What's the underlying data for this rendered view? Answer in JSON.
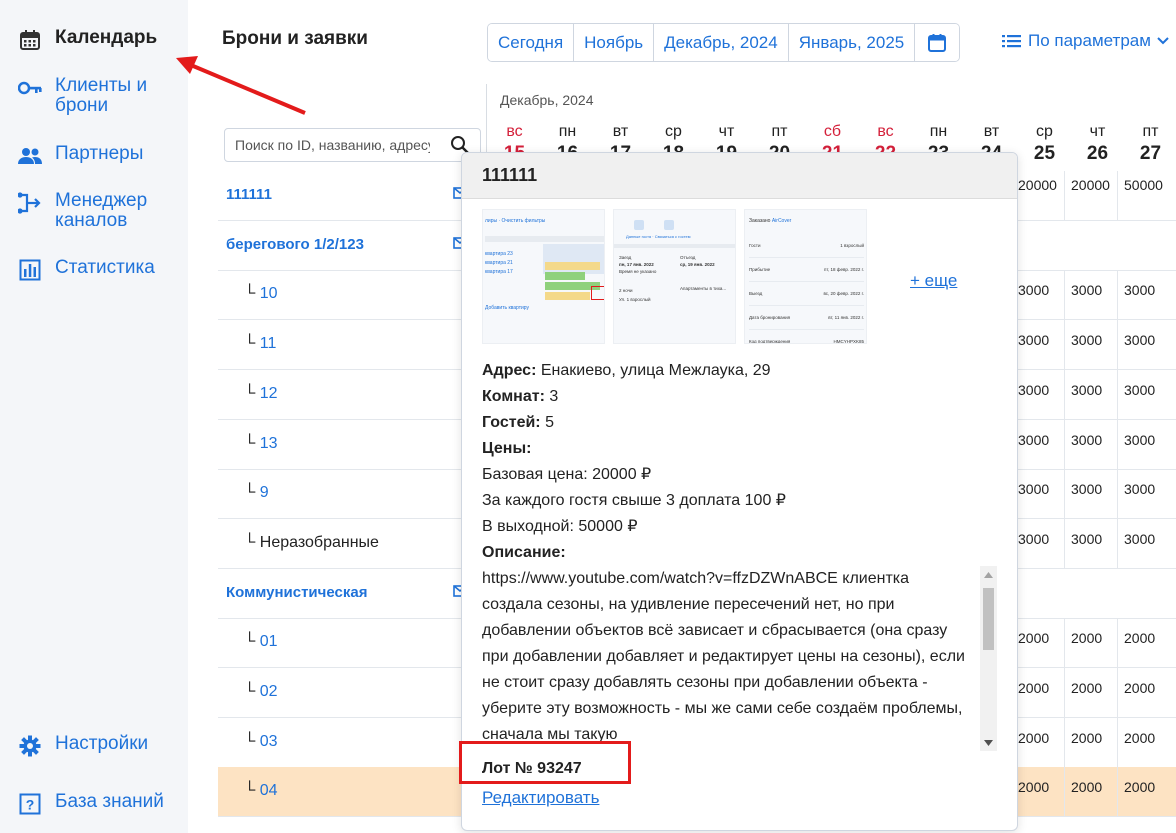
{
  "sidebar": {
    "items": [
      {
        "label": "Календарь",
        "icon": "calendar-icon",
        "active": true
      },
      {
        "label": "Клиенты и брони",
        "icon": "key-icon"
      },
      {
        "label": "Партнеры",
        "icon": "people-icon"
      },
      {
        "label": "Менеджер каналов",
        "icon": "channels-icon"
      },
      {
        "label": "Статистика",
        "icon": "bar-chart-icon"
      }
    ],
    "bottom": [
      {
        "label": "Настройки",
        "icon": "gear-icon"
      },
      {
        "label": "База знаний",
        "icon": "question-icon"
      }
    ]
  },
  "header": {
    "title": "Брони и заявки",
    "datebar": [
      "Сегодня",
      "Ноябрь",
      "Декабрь, 2024",
      "Январь, 2025"
    ],
    "params_label": "По параметрам"
  },
  "search": {
    "placeholder": "Поиск по ID, названию, адресу"
  },
  "calendar": {
    "month": "Декабрь, 2024",
    "days": [
      {
        "wd": "вс",
        "num": "15",
        "weekend": true
      },
      {
        "wd": "пн",
        "num": "16"
      },
      {
        "wd": "вт",
        "num": "17"
      },
      {
        "wd": "ср",
        "num": "18"
      },
      {
        "wd": "чт",
        "num": "19"
      },
      {
        "wd": "пт",
        "num": "20"
      },
      {
        "wd": "сб",
        "num": "21",
        "weekend": true
      },
      {
        "wd": "вс",
        "num": "22",
        "weekend": true
      },
      {
        "wd": "пн",
        "num": "23"
      },
      {
        "wd": "вт",
        "num": "24"
      },
      {
        "wd": "ср",
        "num": "25"
      },
      {
        "wd": "чт",
        "num": "26"
      },
      {
        "wd": "пт",
        "num": "27"
      }
    ]
  },
  "rows": [
    {
      "label": "111111",
      "type": "group",
      "prices": [
        "20000",
        "20000",
        "50000"
      ],
      "mail": true
    },
    {
      "label": "берегового 1/2/123",
      "type": "group",
      "prices": [],
      "mail": true
    },
    {
      "label": "10",
      "type": "child",
      "prices": [
        "3000",
        "3000",
        "3000"
      ]
    },
    {
      "label": "11",
      "type": "child",
      "prices": [
        "3000",
        "3000",
        "3000"
      ]
    },
    {
      "label": "12",
      "type": "child",
      "prices": [
        "3000",
        "3000",
        "3000"
      ]
    },
    {
      "label": "13",
      "type": "child",
      "prices": [
        "3000",
        "3000",
        "3000"
      ]
    },
    {
      "label": "9",
      "type": "child",
      "prices": [
        "3000",
        "3000",
        "3000"
      ]
    },
    {
      "label": "Неразобранные",
      "type": "plain",
      "prices": [
        "3000",
        "3000",
        "3000"
      ]
    },
    {
      "label": "Коммунистическая",
      "type": "group",
      "prices": [],
      "mail": true
    },
    {
      "label": "01",
      "type": "child",
      "prices": [
        "2000",
        "2000",
        "2000"
      ]
    },
    {
      "label": "02",
      "type": "child",
      "prices": [
        "2000",
        "2000",
        "2000"
      ]
    },
    {
      "label": "03",
      "type": "child",
      "prices": [
        "2000",
        "2000",
        "2000"
      ]
    },
    {
      "label": "04",
      "type": "child",
      "prices": [
        "2000",
        "2000",
        "2000"
      ],
      "highlight": true
    }
  ],
  "popup": {
    "title": "111111",
    "more_link": "+ еще",
    "address_label": "Адрес:",
    "address": "Енакиево, улица Межлаука, 29",
    "rooms_label": "Комнат:",
    "rooms": "3",
    "guests_label": "Гостей:",
    "guests": "5",
    "prices_label": "Цены:",
    "base_price": "Базовая цена: 20000 ₽",
    "extra_guest": "За каждого гостя свыше 3 доплата 100 ₽",
    "weekend_price": "В выходной: 50000 ₽",
    "description_label": "Описание:",
    "description": "https://www.youtube.com/watch?v=ffzDZWnABCE клиентка создала сезоны, на удивление пересечений нет, но при добавлении объектов всё зависает и сбрасывается (она сразу при добавлении добавляет и редактирует цены на сезоны), если не стоит сразу добавлять сезоны при добавлении объекта - уберите эту возможность - мы же сами себе создаём проблемы, сначала мы такую",
    "lot": "Лот № 93247",
    "edit_link": "Редактировать"
  },
  "colors": {
    "accent": "#1f72d9",
    "weekend": "#d4203a",
    "highlight_row": "#fde3c3",
    "annotation": "#e31b1b"
  }
}
